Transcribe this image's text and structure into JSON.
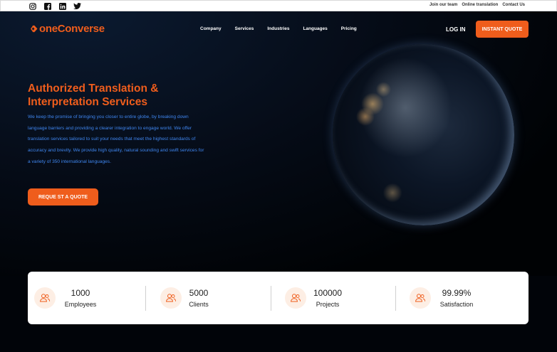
{
  "topbar": {
    "socials": [
      "instagram-icon",
      "facebook-icon",
      "linkedin-icon",
      "twitter-icon"
    ],
    "links": [
      "Join our team",
      "Online translation",
      "Contact Us"
    ]
  },
  "header": {
    "logo_text": "oneConverse",
    "nav": [
      "Company",
      "Services",
      "Industries",
      "Languages",
      "Pricing"
    ],
    "login": "LOG IN",
    "cta": "INSTANT QUOTE"
  },
  "hero": {
    "headline_line1": "Authorized Translation &",
    "headline_line2": "Interpretation Services",
    "description": "We keep the promise of bringing you closer to entire globe, by breaking down language barriers and providing a clearer integration to engage world. We offer translation services tailored to suit your needs that meet the highest standards of accuracy and brevity. We provide high quality, natural sounding and swift services for a variety of 350 international languages.",
    "button": "REQUE ST A QUOTE"
  },
  "stats": [
    {
      "value": "1000",
      "label": "Employees"
    },
    {
      "value": "5000",
      "label": "Clients"
    },
    {
      "value": "100000",
      "label": "Projects"
    },
    {
      "value": "99.99%",
      "label": "Satisfaction"
    }
  ],
  "colors": {
    "accent": "#ef5d1c",
    "link_blue": "#3f86f0",
    "dark_bg": "#03070f"
  }
}
